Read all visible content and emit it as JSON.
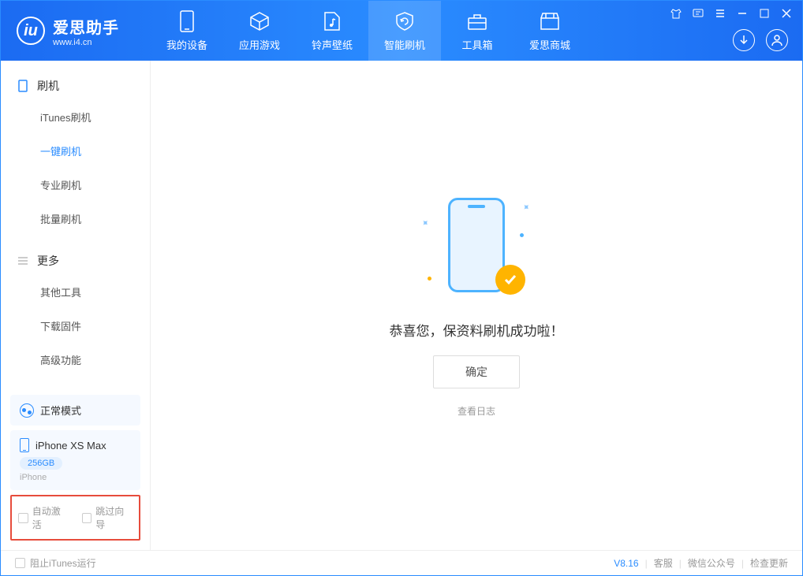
{
  "app": {
    "title": "爱思助手",
    "url": "www.i4.cn"
  },
  "nav": [
    {
      "key": "device",
      "label": "我的设备"
    },
    {
      "key": "apps",
      "label": "应用游戏"
    },
    {
      "key": "ring",
      "label": "铃声壁纸"
    },
    {
      "key": "flash",
      "label": "智能刷机"
    },
    {
      "key": "tools",
      "label": "工具箱"
    },
    {
      "key": "mall",
      "label": "爱思商城"
    }
  ],
  "sidebar": {
    "section1": {
      "title": "刷机",
      "items": [
        "iTunes刷机",
        "一键刷机",
        "专业刷机",
        "批量刷机"
      ],
      "active_index": 1
    },
    "section2": {
      "title": "更多",
      "items": [
        "其他工具",
        "下载固件",
        "高级功能"
      ]
    },
    "mode": {
      "label": "正常模式"
    },
    "device": {
      "name": "iPhone XS Max",
      "storage": "256GB",
      "type": "iPhone"
    },
    "options": {
      "auto_activate": "自动激活",
      "skip_guide": "跳过向导"
    }
  },
  "main": {
    "success_text": "恭喜您，保资料刷机成功啦！",
    "confirm": "确定",
    "view_log": "查看日志"
  },
  "footer": {
    "block_itunes": "阻止iTunes运行",
    "version": "V8.16",
    "links": [
      "客服",
      "微信公众号",
      "检查更新"
    ]
  },
  "colors": {
    "primary": "#2a8cff",
    "accent": "#ffb400"
  }
}
